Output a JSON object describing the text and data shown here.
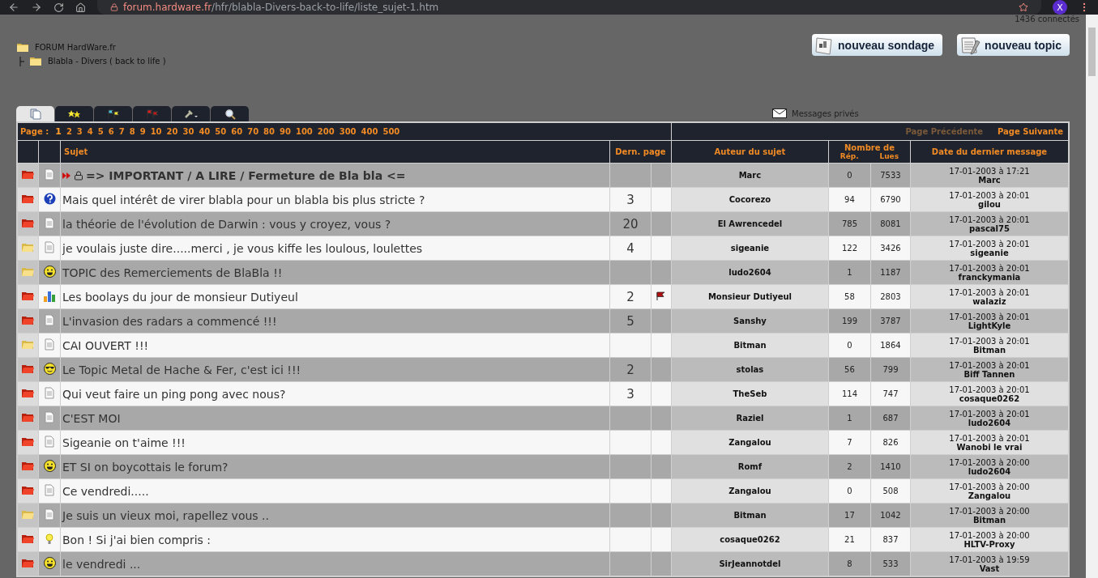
{
  "browser": {
    "url_host": "forum.hardware.fr",
    "url_path": "/hfr/blabla-Divers-back-to-life/liste_sujet-1.htm",
    "profile": "X"
  },
  "connected": "1436 connectés",
  "breadcrumb": {
    "label": "FORUM HardWare.fr",
    "children": [
      {
        "label": "Blabla - Divers ( back to life )"
      }
    ]
  },
  "actions": [
    {
      "label": "nouveau sondage",
      "kind": "poll"
    },
    {
      "label": "nouveau topic",
      "kind": "topic"
    }
  ],
  "tabs": [
    {
      "kind": "topics",
      "selected": true
    },
    {
      "kind": "favorites",
      "selected": false
    },
    {
      "kind": "followed",
      "selected": false
    },
    {
      "kind": "flagged",
      "selected": false
    },
    {
      "kind": "tools",
      "selected": false
    },
    {
      "kind": "search",
      "selected": false
    }
  ],
  "private_messages": "Messages privés",
  "pagination": {
    "label": "Page :",
    "pages": [
      {
        "label": "1",
        "selected": true
      },
      {
        "label": "2",
        "selected": false
      },
      {
        "label": "3",
        "selected": false
      },
      {
        "label": "4",
        "selected": false
      },
      {
        "label": "5",
        "selected": false
      },
      {
        "label": "6",
        "selected": false
      },
      {
        "label": "7",
        "selected": false
      },
      {
        "label": "8",
        "selected": false
      },
      {
        "label": "9",
        "selected": false
      },
      {
        "label": "10",
        "selected": false
      },
      {
        "label": "20",
        "selected": false
      },
      {
        "label": "30",
        "selected": false
      },
      {
        "label": "40",
        "selected": false
      },
      {
        "label": "50",
        "selected": false
      },
      {
        "label": "60",
        "selected": false
      },
      {
        "label": "70",
        "selected": false
      },
      {
        "label": "80",
        "selected": false
      },
      {
        "label": "90",
        "selected": false
      },
      {
        "label": "100",
        "selected": false
      },
      {
        "label": "200",
        "selected": false
      },
      {
        "label": "300",
        "selected": false
      },
      {
        "label": "400",
        "selected": false
      },
      {
        "label": "500",
        "selected": false
      }
    ],
    "previous": {
      "label": "Page Précédente",
      "disabled": true
    },
    "next": {
      "label": "Page Suivante",
      "disabled": false
    }
  },
  "columns": {
    "subject": "Sujet",
    "last_page": "Dern. page",
    "author": "Auteur du sujet",
    "count": "Nombre de",
    "replies": "Rép.",
    "reads": "Lues",
    "last_date": "Date du dernier message"
  },
  "rows": [
    {
      "unread": true,
      "kind": "doc",
      "sticky": true,
      "locked": true,
      "subject": "=> IMPORTANT / A LIRE / Fermeture de Bla bla <=",
      "flagged": false,
      "author": "Marc",
      "replies": "0",
      "reads": "7533",
      "date": "17-01-2003 à 17:21",
      "last_by": "Marc"
    },
    {
      "unread": true,
      "kind": "question",
      "sticky": false,
      "locked": false,
      "subject": "Mais quel intérêt de virer blabla pour un blabla bis plus stricte ?",
      "last_page": "3",
      "flagged": false,
      "author": "Cocorezo",
      "replies": "94",
      "reads": "6790",
      "date": "17-01-2003 à 20:01",
      "last_by": "gilou"
    },
    {
      "unread": true,
      "kind": "doc",
      "sticky": false,
      "locked": false,
      "subject": "la théorie de l'évolution de Darwin : vous y croyez, vous ?",
      "last_page": "20",
      "flagged": false,
      "author": "El Awrencedel",
      "replies": "785",
      "reads": "8081",
      "date": "17-01-2003 à 20:01",
      "last_by": "pascal75"
    },
    {
      "unread": false,
      "kind": "doc",
      "sticky": false,
      "locked": false,
      "subject": "je voulais juste dire.....merci , je vous kiffe les loulous, loulettes",
      "last_page": "4",
      "flagged": false,
      "author": "sigeanie",
      "replies": "122",
      "reads": "3426",
      "date": "17-01-2003 à 20:01",
      "last_by": "sigeanie"
    },
    {
      "unread": false,
      "kind": "smiley",
      "sticky": false,
      "locked": false,
      "subject": "TOPIC des Remerciements de BlaBla !!",
      "flagged": false,
      "author": "ludo2604",
      "replies": "1",
      "reads": "1187",
      "date": "17-01-2003 à 20:01",
      "last_by": "franckymania"
    },
    {
      "unread": true,
      "kind": "chart",
      "sticky": false,
      "locked": false,
      "subject": "Les boolays du jour de monsieur Dutiyeul",
      "last_page": "2",
      "flagged": true,
      "author": "Monsieur Dutiyeul",
      "replies": "58",
      "reads": "2803",
      "date": "17-01-2003 à 20:01",
      "last_by": "walaziz"
    },
    {
      "unread": true,
      "kind": "doc",
      "sticky": false,
      "locked": false,
      "subject": "L'invasion des radars a commencé !!!",
      "last_page": "5",
      "flagged": false,
      "author": "Sanshy",
      "replies": "199",
      "reads": "3787",
      "date": "17-01-2003 à 20:01",
      "last_by": "LightKyle"
    },
    {
      "unread": false,
      "kind": "doc",
      "sticky": false,
      "locked": false,
      "subject": "CAI OUVERT !!!",
      "flagged": false,
      "author": "Bitman",
      "replies": "0",
      "reads": "1864",
      "date": "17-01-2003 à 20:01",
      "last_by": "Bitman"
    },
    {
      "unread": true,
      "kind": "cool",
      "sticky": false,
      "locked": false,
      "subject": "Le Topic Metal de Hache & Fer, c'est ici !!!",
      "last_page": "2",
      "flagged": false,
      "author": "stolas",
      "replies": "56",
      "reads": "799",
      "date": "17-01-2003 à 20:01",
      "last_by": "Biff Tannen"
    },
    {
      "unread": true,
      "kind": "doc",
      "sticky": false,
      "locked": false,
      "subject": "Qui veut faire un ping pong avec nous?",
      "last_page": "3",
      "flagged": false,
      "author": "TheSeb",
      "replies": "114",
      "reads": "747",
      "date": "17-01-2003 à 20:01",
      "last_by": "cosaque0262"
    },
    {
      "unread": true,
      "kind": "doc",
      "sticky": false,
      "locked": false,
      "subject": "C'EST MOI",
      "flagged": false,
      "author": "Raziel",
      "replies": "1",
      "reads": "687",
      "date": "17-01-2003 à 20:01",
      "last_by": "ludo2604"
    },
    {
      "unread": true,
      "kind": "doc",
      "sticky": false,
      "locked": false,
      "subject": "Sigeanie on t'aime !!!",
      "flagged": false,
      "author": "Zangalou",
      "replies": "7",
      "reads": "826",
      "date": "17-01-2003 à 20:01",
      "last_by": "Wanobi le vrai"
    },
    {
      "unread": true,
      "kind": "smiley",
      "sticky": false,
      "locked": false,
      "subject": "ET SI on boycottais le forum?",
      "flagged": false,
      "author": "Romf",
      "replies": "2",
      "reads": "1410",
      "date": "17-01-2003 à 20:00",
      "last_by": "ludo2604"
    },
    {
      "unread": true,
      "kind": "doc",
      "sticky": false,
      "locked": false,
      "subject": "Ce vendredi.....",
      "flagged": false,
      "author": "Zangalou",
      "replies": "0",
      "reads": "508",
      "date": "17-01-2003 à 20:00",
      "last_by": "Zangalou"
    },
    {
      "unread": false,
      "kind": "doc",
      "sticky": false,
      "locked": false,
      "subject": "Je suis un vieux moi, rapellez vous ..",
      "flagged": false,
      "author": "Bitman",
      "replies": "17",
      "reads": "1042",
      "date": "17-01-2003 à 20:00",
      "last_by": "Bitman"
    },
    {
      "unread": true,
      "kind": "bulb",
      "sticky": false,
      "locked": false,
      "subject": "Bon ! Si j'ai bien compris :",
      "flagged": false,
      "author": "cosaque0262",
      "replies": "21",
      "reads": "837",
      "date": "17-01-2003 à 20:00",
      "last_by": "HLTV-Proxy"
    },
    {
      "unread": true,
      "kind": "smiley",
      "sticky": false,
      "locked": false,
      "subject": "le vendredi ...",
      "flagged": false,
      "author": "SirJeannotdel",
      "replies": "8",
      "reads": "533",
      "date": "17-01-2003 à 19:59",
      "last_by": "Vast"
    }
  ]
}
